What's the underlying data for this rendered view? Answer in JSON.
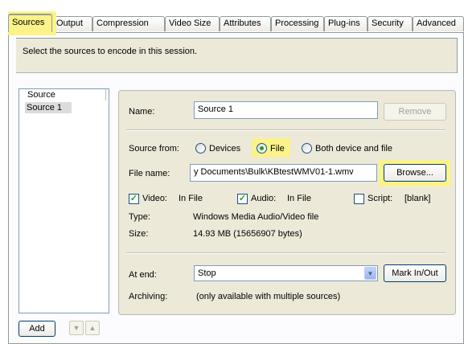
{
  "tabs": [
    {
      "label": "Sources",
      "active": true
    },
    {
      "label": "Output"
    },
    {
      "label": "Compression"
    },
    {
      "label": "Video Size"
    },
    {
      "label": "Attributes"
    },
    {
      "label": "Processing"
    },
    {
      "label": "Plug-ins"
    },
    {
      "label": "Security"
    },
    {
      "label": "Advanced"
    }
  ],
  "description": "Select the sources to encode in this session.",
  "source_list": {
    "header": "Source",
    "items": [
      "Source 1"
    ],
    "add_label": "Add",
    "up_icon": "up-triangle",
    "down_icon": "down-triangle"
  },
  "details": {
    "name_label": "Name:",
    "name_value": "Source 1",
    "remove_label": "Remove",
    "source_from_label": "Source from:",
    "option_devices": "Devices",
    "option_file": "File",
    "option_both": "Both device and file",
    "selected_option": "File",
    "file_name_label": "File name:",
    "file_name_value": "y Documents\\Bulk\\KBtestWMV01-1.wmv",
    "browse_label": "Browse...",
    "video_label": "Video:",
    "video_value": "In File",
    "audio_label": "Audio:",
    "audio_value": "In File",
    "script_label": "Script:",
    "script_value": "[blank]",
    "type_label": "Type:",
    "type_value": "Windows Media Audio/Video file",
    "size_label": "Size:",
    "size_value": "14.93 MB (15656907 bytes)",
    "at_end_label": "At end:",
    "at_end_value": "Stop",
    "mark_label": "Mark In/Out",
    "archiving_label": "Archiving:",
    "archiving_value": "(only available with multiple sources)"
  },
  "colors": {
    "highlight": "#fbf38a",
    "active_tab_accent": "#e68b2c",
    "panel_bg": "#ece9d8",
    "check_green": "#21a121"
  }
}
